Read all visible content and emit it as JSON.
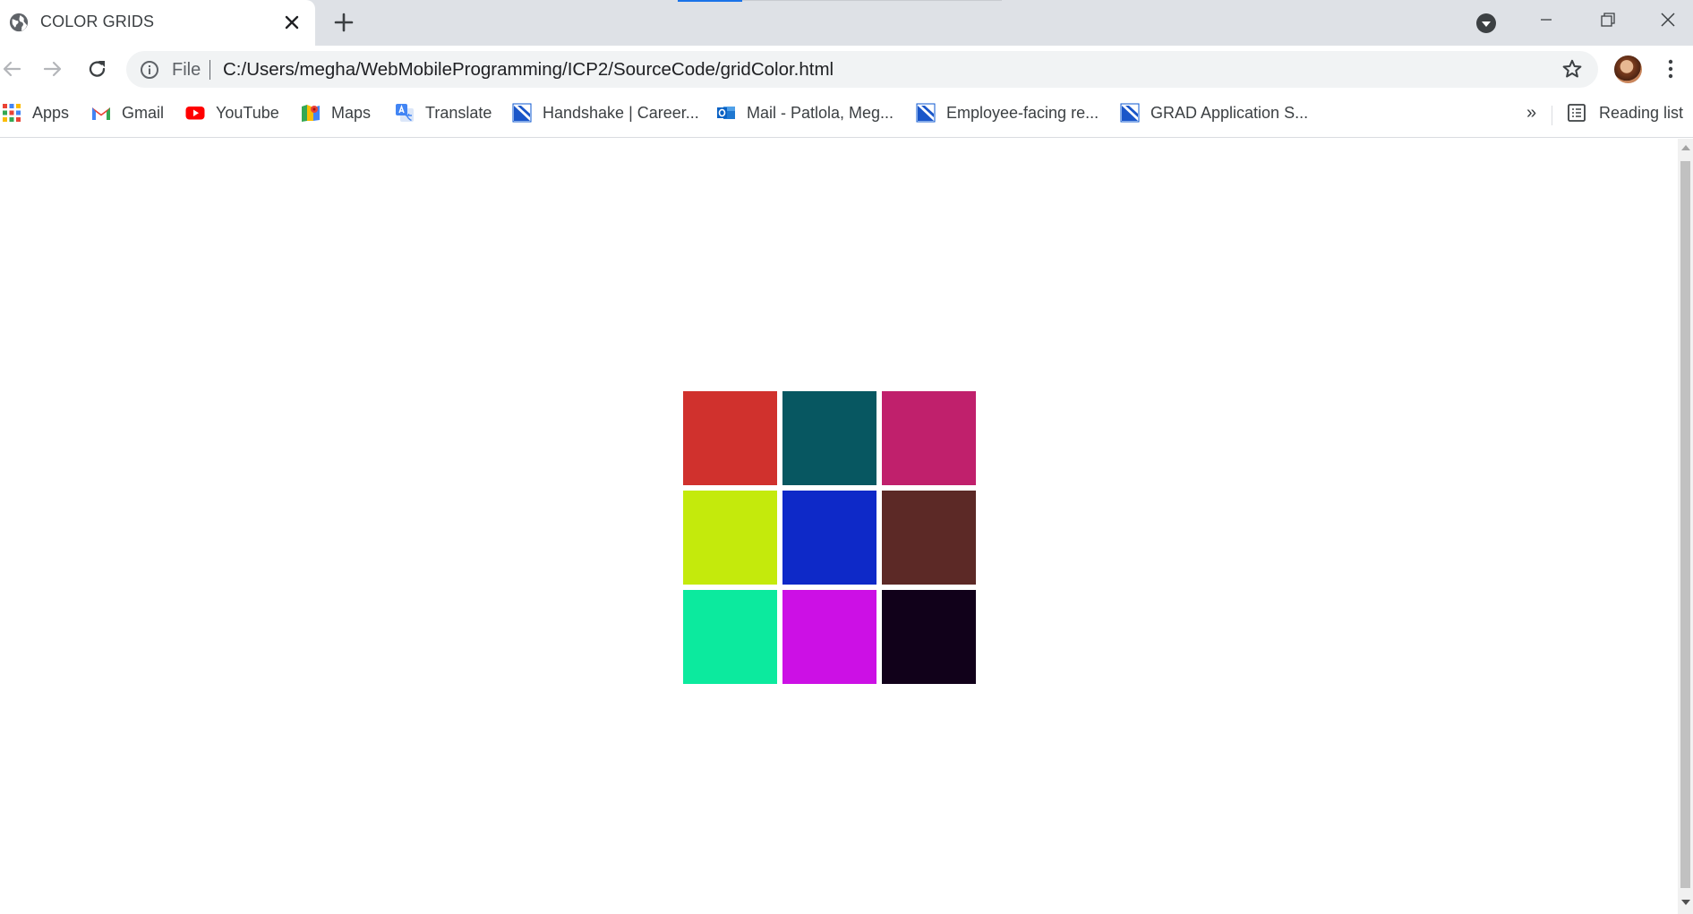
{
  "window": {
    "tab_title": "COLOR GRIDS",
    "icons": {
      "favicon": "globe-icon",
      "tab_close": "close-icon",
      "new_tab": "plus-icon",
      "tab_search": "tab-search-icon",
      "minimize": "minimize-icon",
      "restore": "restore-icon",
      "close": "close-icon"
    }
  },
  "toolbar": {
    "scheme_label": "File",
    "url": "C:/Users/megha/WebMobileProgramming/ICP2/SourceCode/gridColor.html",
    "icons": {
      "back": "back-arrow-icon",
      "forward": "forward-arrow-icon",
      "reload": "reload-icon",
      "site_info": "info-icon",
      "bookmark": "star-icon",
      "profile": "avatar",
      "menu": "kebab-menu-icon"
    }
  },
  "bookmarks": {
    "items": [
      {
        "label": "Apps",
        "icon": "apps-grid-icon"
      },
      {
        "label": "Gmail",
        "icon": "gmail-icon"
      },
      {
        "label": "YouTube",
        "icon": "youtube-icon"
      },
      {
        "label": "Maps",
        "icon": "maps-icon"
      },
      {
        "label": "Translate",
        "icon": "translate-icon"
      },
      {
        "label": "Handshake | Career...",
        "icon": "handshake-icon"
      },
      {
        "label": "Mail - Patlola, Meg...",
        "icon": "outlook-icon"
      },
      {
        "label": "Employee-facing re...",
        "icon": "handshake-icon"
      },
      {
        "label": "GRAD Application S...",
        "icon": "handshake-icon"
      }
    ],
    "overflow_label": "»",
    "reading_list_label": "Reading list"
  },
  "page": {
    "grid_colors": [
      "#d0312d",
      "#075761",
      "#c0206c",
      "#c4ea0c",
      "#0e29c8",
      "#5c2926",
      "#0cea9e",
      "#cc10e5",
      "#11011a"
    ]
  }
}
